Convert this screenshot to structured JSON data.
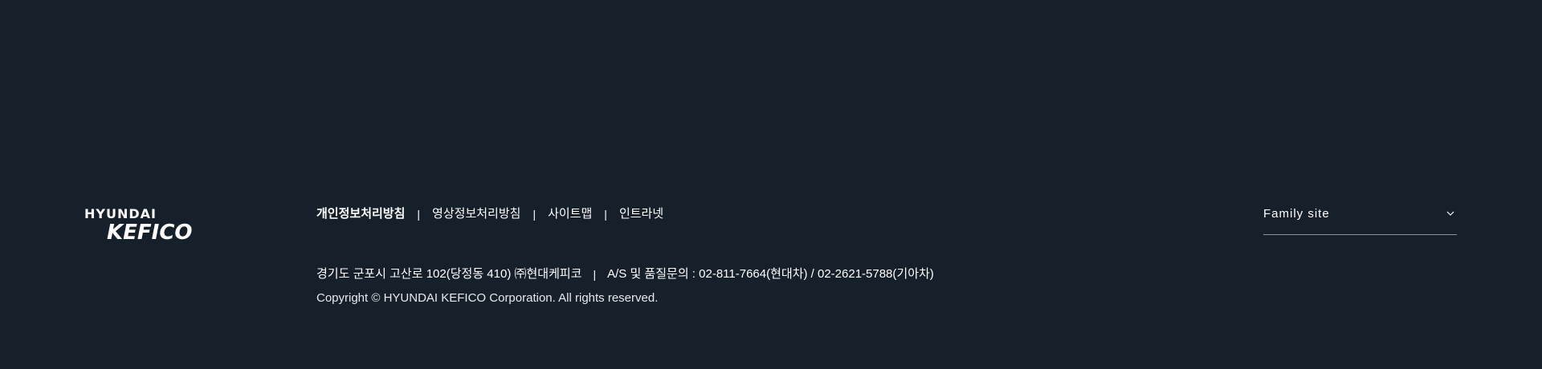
{
  "logo": {
    "line1": "HYUNDAI",
    "line2": "KEFICO"
  },
  "policy_links": [
    {
      "label": "개인정보처리방침"
    },
    {
      "label": "영상정보처리방침"
    },
    {
      "label": "사이트맵"
    },
    {
      "label": "인트라넷"
    }
  ],
  "separator": "|",
  "address": {
    "location": "경기도 군포시 고산로 102(당정동 410) ㈜현대케피코",
    "contact": "A/S 및 품질문의 : 02-811-7664(현대차) / 02-2621-5788(기아차)"
  },
  "copyright": "Copyright © HYUNDAI KEFICO Corporation. All rights reserved.",
  "family_site": {
    "label": "Family site",
    "icon": "chevron-down-icon"
  },
  "colors": {
    "background": "#16202b",
    "text": "#ffffff",
    "divider": "#8a929c"
  }
}
